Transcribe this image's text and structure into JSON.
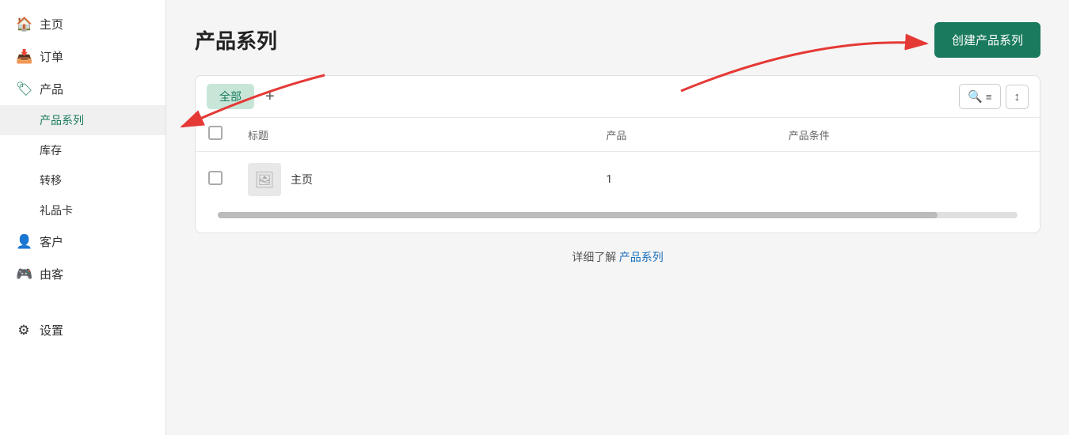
{
  "sidebar": {
    "items": [
      {
        "id": "home",
        "label": "主页",
        "icon": "🏠",
        "active": false
      },
      {
        "id": "orders",
        "label": "订单",
        "icon": "📥",
        "active": false
      },
      {
        "id": "products",
        "label": "产品",
        "icon": "🏷",
        "active": false
      }
    ],
    "sub_items": [
      {
        "id": "product-series",
        "label": "产品系列",
        "active": true
      },
      {
        "id": "inventory",
        "label": "库存",
        "active": false
      },
      {
        "id": "transfer",
        "label": "转移",
        "active": false
      },
      {
        "id": "gift-card",
        "label": "礼品卡",
        "active": false
      }
    ],
    "items2": [
      {
        "id": "customers",
        "label": "客户",
        "icon": "👤",
        "active": false
      },
      {
        "id": "marketing",
        "label": "由客",
        "icon": "🎮",
        "active": false
      }
    ],
    "items3": [
      {
        "id": "settings",
        "label": "设置",
        "icon": "⚙",
        "active": false
      }
    ]
  },
  "main": {
    "page_title": "产品系列",
    "create_button_label": "创建产品系列",
    "tabs": [
      {
        "id": "all",
        "label": "全部",
        "active": true
      }
    ],
    "add_tab_icon": "+",
    "toolbar": {
      "search_filter_icon": "search-filter-icon",
      "sort_icon": "sort-icon"
    },
    "table": {
      "columns": [
        {
          "id": "checkbox",
          "label": ""
        },
        {
          "id": "title",
          "label": "标题"
        },
        {
          "id": "products",
          "label": "产品"
        },
        {
          "id": "conditions",
          "label": "产品条件"
        }
      ],
      "rows": [
        {
          "id": "row-1",
          "title": "主页",
          "products": "1",
          "conditions": ""
        }
      ]
    },
    "bottom_text": "详细了解",
    "bottom_link_text": "产品系列",
    "bottom_link_url": "#"
  }
}
